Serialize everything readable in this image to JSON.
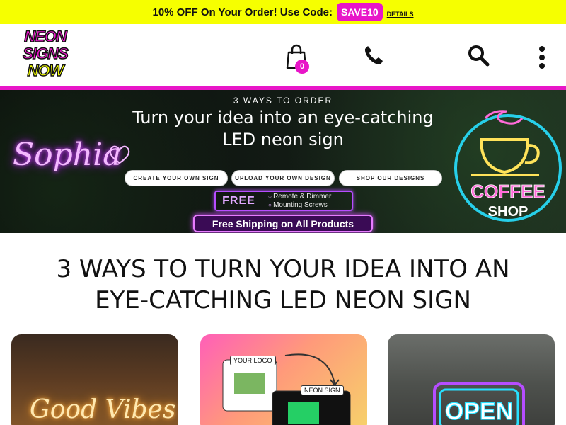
{
  "promo": {
    "text": "10% OFF On Your Order! Use Code:",
    "code": "SAVE10",
    "link": "DETAILS"
  },
  "header": {
    "logo_lines": [
      "NEON",
      "SIGNS",
      "NOW"
    ],
    "cart_count": "0",
    "icons": [
      "cart-icon",
      "phone-icon",
      "search-icon",
      "more-vertical-icon"
    ]
  },
  "hero": {
    "kicker": "3 WAYS TO ORDER",
    "title": "Turn your idea into an eye-catching LED neon sign",
    "sample_text": "Sophia",
    "buttons": [
      "CREATE YOUR OWN SIGN",
      "UPLOAD YOUR OWN DESIGN",
      "SHOP OUR DESIGNS"
    ],
    "free_label": "FREE",
    "free_items": [
      "Remote & Dimmer",
      "Mounting Screws"
    ],
    "shipping": "Free Shipping on All Products",
    "coffee_sign": [
      "COFFEE",
      "SHOP"
    ]
  },
  "section": {
    "title": "3 WAYS TO TURN YOUR IDEA INTO AN EYE-CATCHING LED NEON SIGN"
  },
  "cards": [
    {
      "neon_text": "Good Vibes"
    },
    {
      "tag_logo": "YOUR LOGO",
      "tag_neon": "NEON SIGN"
    },
    {
      "neon_text": "OPEN"
    }
  ],
  "colors": {
    "promo_bg": "#f6ff00",
    "accent": "#e816c8"
  }
}
